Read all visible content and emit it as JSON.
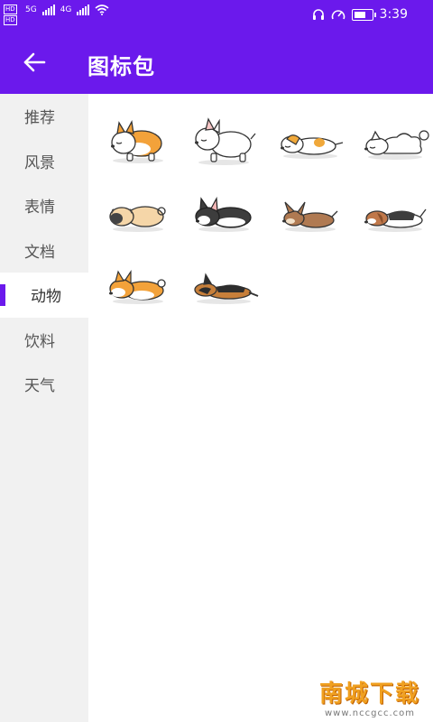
{
  "status_bar": {
    "hd_top": "HD",
    "hd_bottom": "HD",
    "network1": "5G",
    "network2": "4G",
    "time": "3:39",
    "battery_level": 0.85
  },
  "app_bar": {
    "back_icon": "arrow-left-icon",
    "title": "图标包"
  },
  "sidebar": {
    "items": [
      {
        "label": "推荐"
      },
      {
        "label": "风景"
      },
      {
        "label": "表情"
      },
      {
        "label": "文档"
      },
      {
        "label": "动物"
      },
      {
        "label": "饮料"
      },
      {
        "label": "天气"
      }
    ],
    "active_index": 4
  },
  "icons": [
    {
      "name": "corgi-sleeping-icon"
    },
    {
      "name": "white-bull-terrier-icon"
    },
    {
      "name": "jack-russell-sleeping-icon"
    },
    {
      "name": "white-fluffy-dog-icon"
    },
    {
      "name": "pug-sleeping-icon"
    },
    {
      "name": "black-white-bulldog-icon"
    },
    {
      "name": "brown-chihuahua-icon"
    },
    {
      "name": "beagle-sleeping-icon"
    },
    {
      "name": "shiba-inu-sleeping-icon"
    },
    {
      "name": "german-shepherd-sleeping-icon"
    }
  ],
  "watermark": {
    "logo": "南城下载",
    "url": "www.nccgcc.com"
  },
  "colors": {
    "accent": "#6b19ec",
    "sidebar_bg": "#f1f1f1"
  }
}
